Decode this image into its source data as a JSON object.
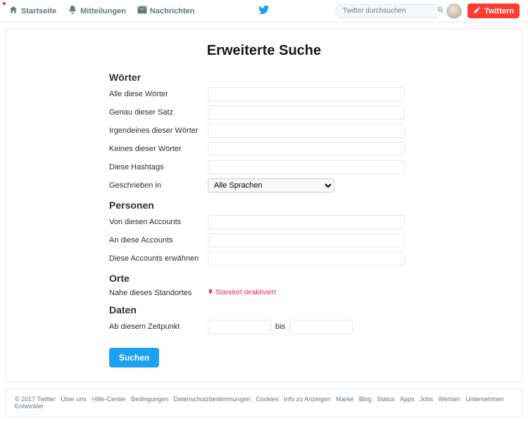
{
  "nav": {
    "home": "Startseite",
    "notifications": "Mitteilungen",
    "messages": "Nachrichten"
  },
  "search_placeholder": "Twitter durchsuchen",
  "tweet_button": "Twittern",
  "page_title": "Erweiterte Suche",
  "sections": {
    "words": {
      "heading": "Wörter",
      "all_these_words": "Alle diese Wörter",
      "exact_phrase": "Genau dieser Satz",
      "any_of_words": "Irgendeines dieser Wörter",
      "none_of_words": "Keines dieser Wörter",
      "hashtags": "Diese Hashtags",
      "written_in": "Geschrieben in",
      "language_selected": "Alle Sprachen"
    },
    "people": {
      "heading": "Personen",
      "from_accounts": "Von diesen Accounts",
      "to_accounts": "An diese Accounts",
      "mentioning": "Diese Accounts erwähnen"
    },
    "places": {
      "heading": "Orte",
      "near_location": "Nahe dieses Standortes",
      "location_disabled": "Standort deaktiviert"
    },
    "dates": {
      "heading": "Daten",
      "from_date": "Ab diesem Zeitpunkt",
      "to": "bis"
    }
  },
  "search_button": "Suchen",
  "footer": {
    "copyright": "© 2017 Twitter",
    "links": [
      "Über uns",
      "Hilfe-Center",
      "Bedingungen",
      "Datenschutzbestimmungen",
      "Cookies",
      "Info zu Anzeigen",
      "Marke",
      "Blog",
      "Status",
      "Apps",
      "Jobs",
      "Werben",
      "Unternehmen",
      "Entwickler"
    ]
  }
}
